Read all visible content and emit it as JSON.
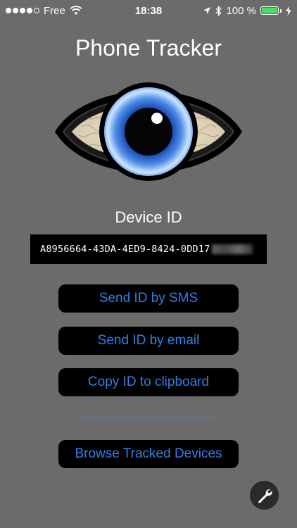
{
  "status_bar": {
    "carrier": "Free",
    "time": "18:38",
    "battery_percent": "100 %",
    "battery_level": 1.0,
    "signal_bars_filled": 4,
    "signal_bars_total": 5
  },
  "app": {
    "title": "Phone Tracker"
  },
  "device": {
    "label": "Device ID",
    "id_visible": "A8956664-43DA-4ED9-8424-0DD17"
  },
  "actions": {
    "send_sms": "Send ID by SMS",
    "send_email": "Send ID by email",
    "copy_clipboard": "Copy ID to clipboard",
    "browse_devices": "Browse Tracked Devices"
  },
  "colors": {
    "background": "#6b6b6b",
    "button_bg": "#000000",
    "accent": "#2f7fe6",
    "battery": "#4cd964"
  },
  "icons": {
    "settings": "wrench-icon",
    "logo": "eye-icon"
  }
}
